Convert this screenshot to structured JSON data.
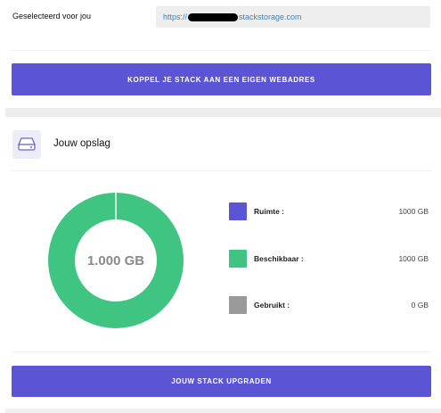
{
  "selected": {
    "label": "Geselecteerd voor jou",
    "url_prefix": "https://",
    "url_suffix": "stackstorage.com"
  },
  "buttons": {
    "connect_label": "KOPPEL JE STACK AAN EEN EIGEN WEBADRES",
    "upgrade_label": "JOUW STACK UPGRADEN"
  },
  "storage": {
    "title": "Jouw opslag",
    "icon": "hard-drive-icon",
    "center_text": "1.000 GB",
    "legend": [
      {
        "label": "Ruimte :",
        "value": "1000 GB",
        "color": "#5b55d6"
      },
      {
        "label": "Beschikbaar :",
        "value": "1000 GB",
        "color": "#3fc482"
      },
      {
        "label": "Gebruikt :",
        "value": "0 GB",
        "color": "#9a9a9a"
      }
    ],
    "donut": {
      "available_fraction": 1.0,
      "used_fraction": 0.0,
      "available_color": "#3fc482",
      "used_color": "#9a9a9a"
    }
  },
  "colors": {
    "accent": "#5b55d6",
    "link": "#2f86d8"
  }
}
